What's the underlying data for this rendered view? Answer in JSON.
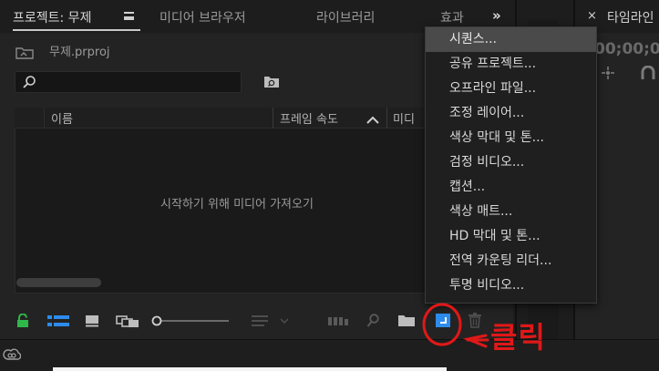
{
  "tabs": {
    "project": "프로젝트: 무제",
    "media_browser": "미디어 브라우저",
    "libraries": "라이브러리",
    "effects": "효과",
    "overflow": "»"
  },
  "project": {
    "filename": "무제.prproj",
    "search": {
      "value": "",
      "placeholder": ""
    },
    "columns": [
      "이름",
      "프레임 속도",
      "미디"
    ],
    "empty_message": "시작하기 위해 미디어 가져오기"
  },
  "new_item_menu": {
    "items": [
      "시퀀스...",
      "공유 프로젝트...",
      "오프라인 파일...",
      "조정 레이어...",
      "색상 막대 및 톤...",
      "검정 비디오...",
      "캡션...",
      "색상 매트...",
      "HD 막대 및 톤...",
      "전역 카운팅 리더...",
      "투명 비디오..."
    ],
    "highlighted_index": 0
  },
  "timeline": {
    "close": "×",
    "tab_label": "타임라인",
    "timecode": "00;00;00"
  },
  "annotation": {
    "text": "<- 클릭",
    "color": "#e01818"
  },
  "colors": {
    "accent_green": "#2fb84a",
    "accent_blue": "#2d8ceb",
    "menu_highlight": "#4a4a4a"
  },
  "icons": [
    "file-icon",
    "search-icon",
    "new-bin-icon",
    "lock-icon",
    "list-view-icon",
    "icon-view-icon",
    "freeform-view-icon",
    "zoom-slider",
    "sort-icon",
    "automate-icon",
    "find-icon",
    "new-item-icon",
    "trash-icon",
    "creative-cloud-icon"
  ]
}
